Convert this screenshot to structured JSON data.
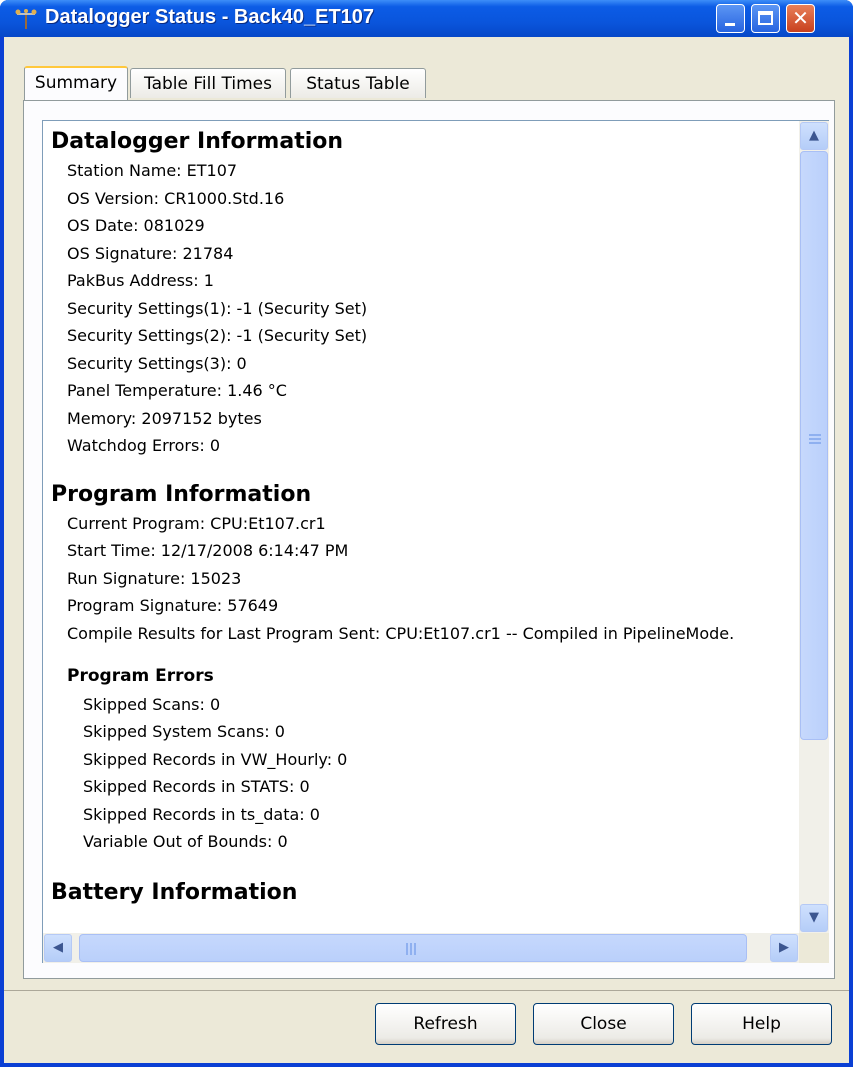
{
  "window": {
    "title": "Datalogger Status - Back40_ET107"
  },
  "tabs": [
    {
      "label": "Summary",
      "active": true
    },
    {
      "label": "Table Fill Times",
      "active": false
    },
    {
      "label": "Status Table",
      "active": false
    }
  ],
  "summary": {
    "datalogger_heading": "Datalogger Information",
    "datalogger_lines": [
      "Station Name: ET107",
      "OS Version: CR1000.Std.16",
      "OS Date: 081029",
      "OS Signature: 21784",
      "PakBus Address: 1",
      "Security Settings(1):  -1 (Security Set)",
      "Security Settings(2):  -1 (Security Set)",
      "Security Settings(3):  0",
      "Panel Temperature: 1.46 °C",
      "Memory: 2097152 bytes",
      "Watchdog Errors: 0"
    ],
    "program_heading": "Program Information",
    "program_lines": [
      "Current Program: CPU:Et107.cr1",
      "Start Time: 12/17/2008 6:14:47 PM",
      "Run Signature: 15023",
      "Program Signature: 57649",
      "Compile Results for Last Program Sent: CPU:Et107.cr1 -- Compiled in PipelineMode."
    ],
    "errors_heading": "Program Errors",
    "error_lines": [
      "Skipped Scans: 0",
      "Skipped System Scans: 0",
      "Skipped Records in VW_Hourly:  0",
      "Skipped Records in STATS:  0",
      "Skipped Records in ts_data:  0",
      "Variable Out of Bounds: 0"
    ],
    "battery_heading": "Battery Information"
  },
  "buttons": {
    "refresh": "Refresh",
    "close": "Close",
    "help": "Help"
  },
  "colors": {
    "titlebar": "#0a55dc",
    "window_bg": "#ece9d8",
    "close_button": "#c8401e"
  }
}
